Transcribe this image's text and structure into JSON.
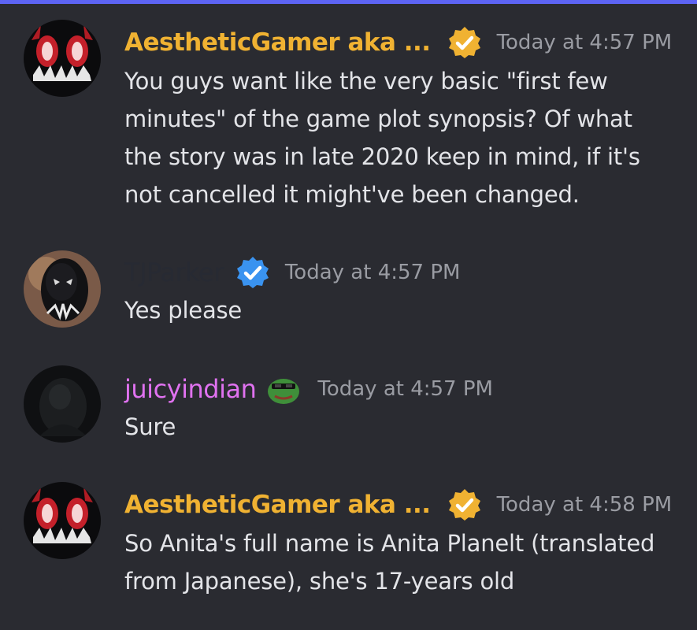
{
  "accent_color": "#5d64f4",
  "messages": [
    {
      "username": "AestheticGamer aka ...",
      "name_color": "#f0b232",
      "badge": "verified-gold-badge",
      "timestamp": "Today at 4:57 PM",
      "lines": [
        "You guys want like the very basic \"first few",
        "minutes\" of the game plot synopsis? Of what",
        "the story was in late 2020 keep in mind, if it's",
        "not cancelled it might've been changed."
      ]
    },
    {
      "username": "TJParker",
      "name_color": "#272a33",
      "badge": "verified-blue-badge",
      "timestamp": "Today at 4:57 PM",
      "lines": [
        "Yes please"
      ]
    },
    {
      "username": "juicyindian",
      "name_color": "#e072f0",
      "badge": "pepe-emoji-icon",
      "timestamp": "Today at 4:57 PM",
      "lines": [
        "Sure"
      ]
    },
    {
      "username": "AestheticGamer aka ...",
      "name_color": "#f0b232",
      "badge": "verified-gold-badge",
      "timestamp": "Today at 4:58 PM",
      "lines": [
        "So Anita's full name is Anita Planelt (translated",
        "from Japanese), she's 17-years old"
      ]
    }
  ]
}
